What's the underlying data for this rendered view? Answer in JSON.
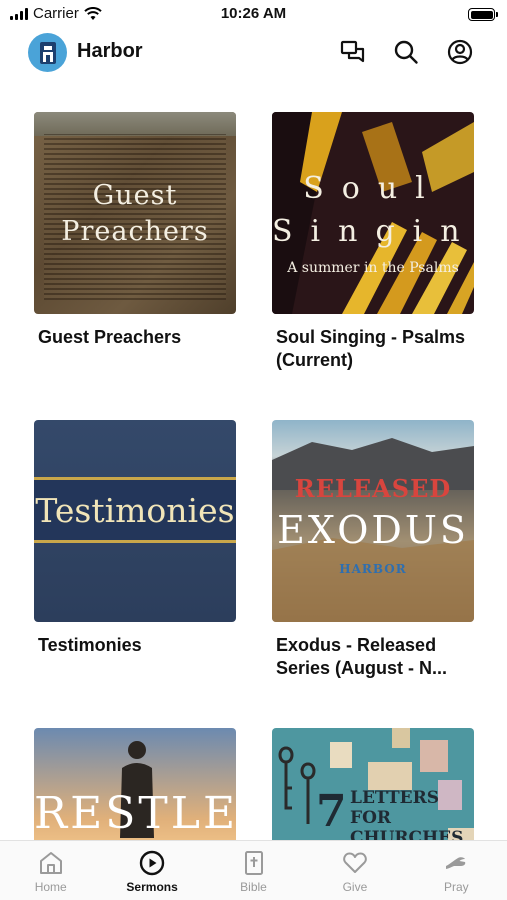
{
  "status_bar": {
    "carrier": "Carrier",
    "time": "10:26 AM"
  },
  "header": {
    "title": "Harbor"
  },
  "cards": [
    {
      "title": "Guest Preachers",
      "thumb_lines": [
        "Guest",
        "Preachers"
      ]
    },
    {
      "title": "Soul Singing - Psalms (Current)",
      "thumb_big": "Soul Singing",
      "thumb_sub": "A summer in the Psalms"
    },
    {
      "title": "Testimonies",
      "thumb_text": "Testimonies"
    },
    {
      "title": "Exodus - Released Series (August - N...",
      "thumb_red": "RELEASED",
      "thumb_main": "EXODUS",
      "thumb_brand": "HARBOR"
    },
    {
      "title": "",
      "thumb_text": "RESTLESS"
    },
    {
      "title": "",
      "thumb_num": "7",
      "thumb_text": "LETTERS FOR CHURCHES"
    }
  ],
  "tabs": [
    {
      "label": "Home",
      "icon": "home-icon",
      "active": false
    },
    {
      "label": "Sermons",
      "icon": "play-circle-icon",
      "active": true
    },
    {
      "label": "Bible",
      "icon": "bible-icon",
      "active": false
    },
    {
      "label": "Give",
      "icon": "heart-icon",
      "active": false
    },
    {
      "label": "Pray",
      "icon": "pray-icon",
      "active": false
    }
  ],
  "colors": {
    "accent": "#111111",
    "logo_bg": "#4aa3d8",
    "inactive_tab": "#9a9a9a"
  }
}
